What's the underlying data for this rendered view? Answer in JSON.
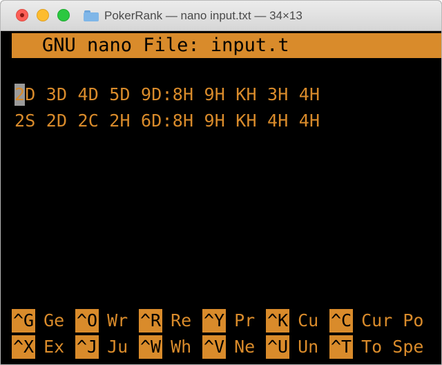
{
  "window": {
    "title": "PokerRank — nano input.txt — 34×13"
  },
  "nano": {
    "header": "GNU nano File: input.t",
    "cursor_char": "2",
    "lines": [
      "D 3D 4D 5D 9D:8H 9H KH 3H 4H",
      "2S 2D 2C 2H 6D:8H 9H KH 4H 4H"
    ],
    "shortcuts_row1": [
      {
        "key": "^G",
        "label": "Ge"
      },
      {
        "key": "^O",
        "label": "Wr"
      },
      {
        "key": "^R",
        "label": "Re"
      },
      {
        "key": "^Y",
        "label": "Pr"
      },
      {
        "key": "^K",
        "label": "Cu"
      },
      {
        "key": "^C",
        "label": "Cur Po"
      }
    ],
    "shortcuts_row2": [
      {
        "key": "^X",
        "label": "Ex"
      },
      {
        "key": "^J",
        "label": "Ju"
      },
      {
        "key": "^W",
        "label": "Wh"
      },
      {
        "key": "^V",
        "label": "Ne"
      },
      {
        "key": "^U",
        "label": "Un"
      },
      {
        "key": "^T",
        "label": "To Spe"
      }
    ]
  },
  "colors": {
    "text": "#d98b2b",
    "background": "#000000"
  }
}
